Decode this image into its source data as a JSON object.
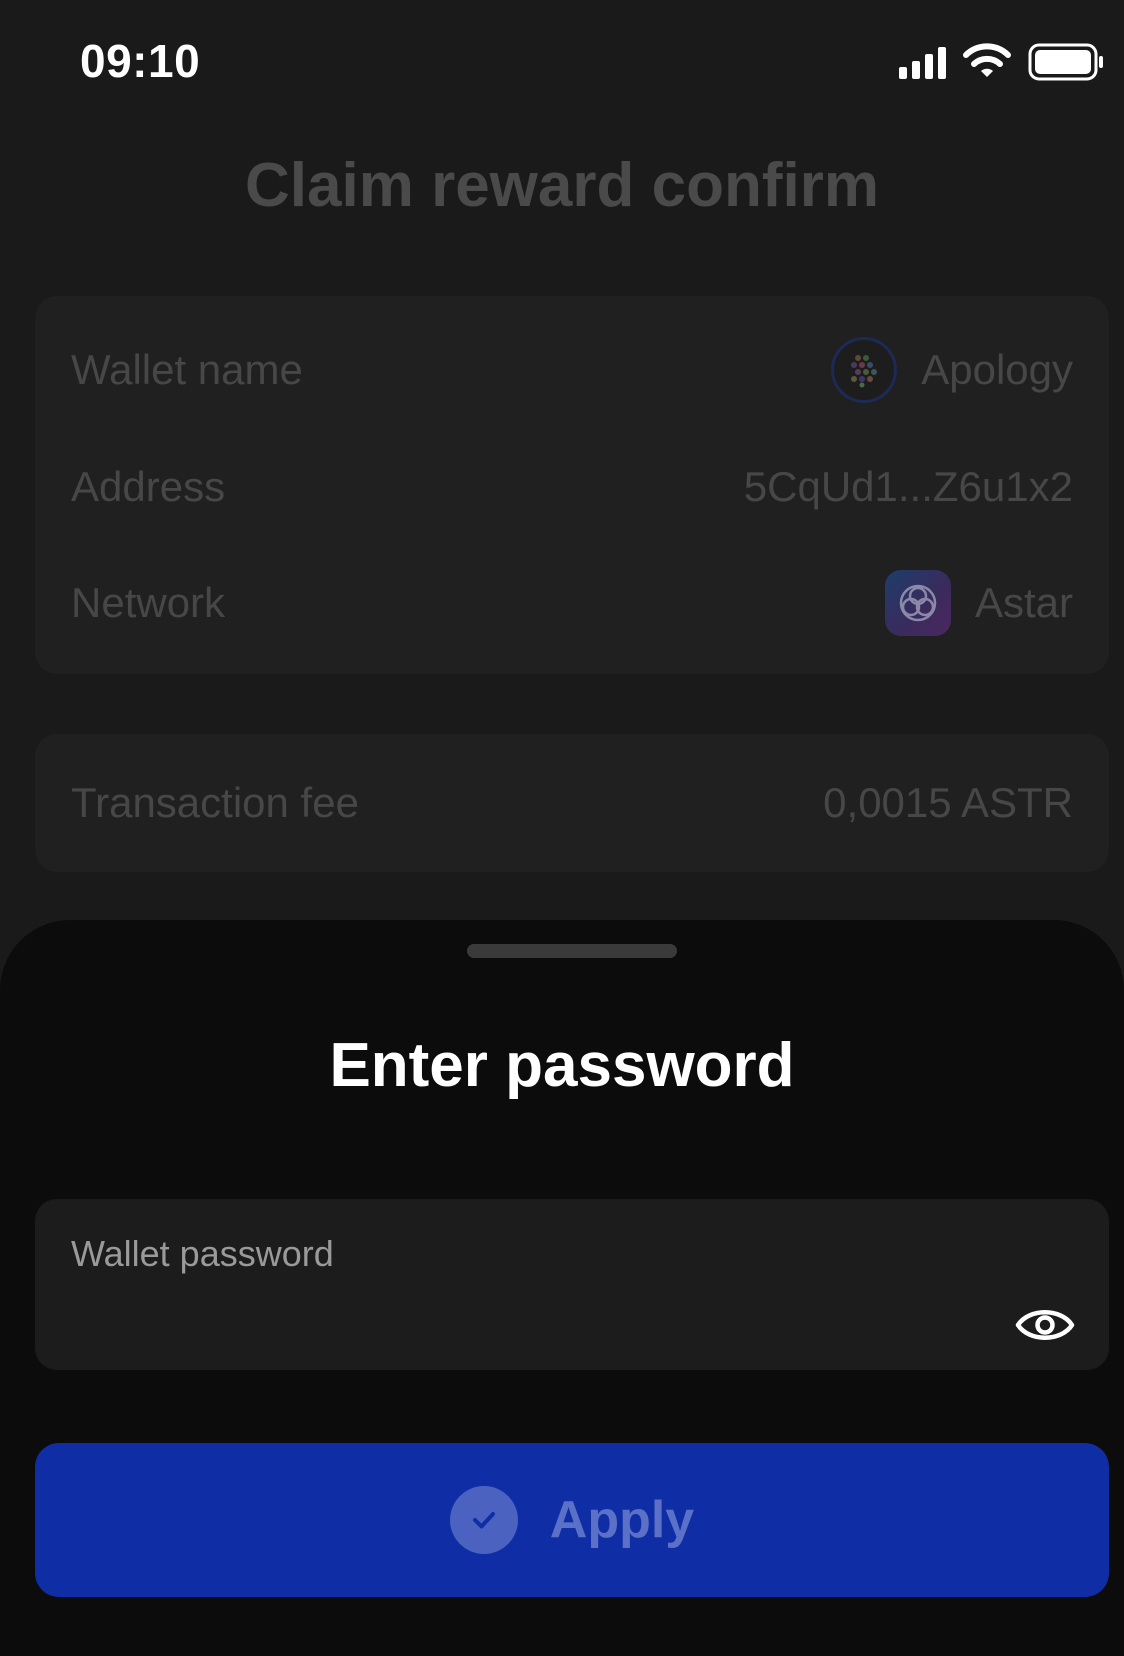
{
  "status_bar": {
    "time": "09:10",
    "icons": [
      "signal-icon",
      "wifi-icon",
      "battery-icon"
    ]
  },
  "page": {
    "title": "Claim reward confirm",
    "info": {
      "wallet_name_label": "Wallet name",
      "wallet_name_value": "Apology",
      "address_label": "Address",
      "address_value": "5CqUd1...Z6u1x2",
      "network_label": "Network",
      "network_value": "Astar"
    },
    "fee": {
      "label": "Transaction fee",
      "value": "0,0015 ASTR"
    }
  },
  "sheet": {
    "title": "Enter password",
    "password_field": {
      "label": "Wallet password",
      "value": ""
    },
    "apply_button": {
      "label": "Apply"
    }
  },
  "colors": {
    "accent": "#0f2ea6",
    "background": "#1a1a1a",
    "sheet": "#0c0c0c"
  }
}
